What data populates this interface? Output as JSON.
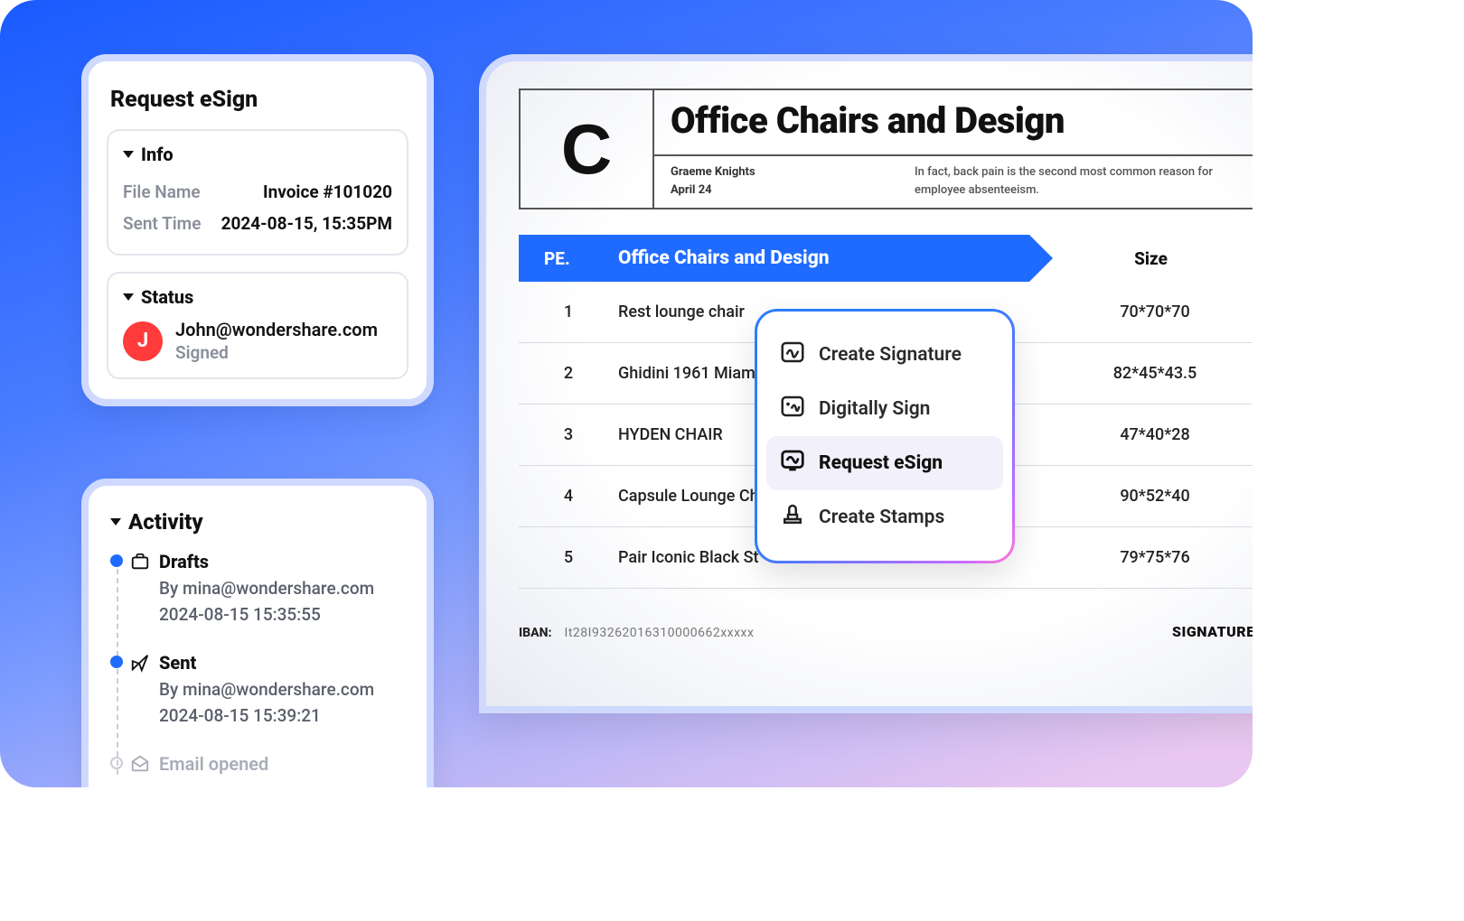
{
  "request_panel": {
    "title": "Request eSign",
    "info_section": "Info",
    "file_label": "File Name",
    "file_value": "Invoice #101020",
    "sent_label": "Sent Time",
    "sent_value": "2024-08-15, 15:35PM",
    "status_section": "Status",
    "avatar_letter": "J",
    "email": "John@wondershare.com",
    "signed": "Signed"
  },
  "activity_panel": {
    "title": "Activity",
    "items": [
      {
        "title": "Drafts",
        "by": "By mina@wondershare.com",
        "time": "2024-08-15 15:35:55"
      },
      {
        "title": "Sent",
        "by": "By mina@wondershare.com",
        "time": "2024-08-15 15:39:21"
      },
      {
        "title": "Email opened"
      }
    ]
  },
  "document": {
    "logo_letter": "C",
    "title": "Office Chairs and Design",
    "author": "Graeme Knights",
    "date": "April 24",
    "blurb": "In fact, back pain is the second most common reason for employee absenteeism.",
    "banner_pe": "PE.",
    "banner_main": "Office Chairs and Design",
    "banner_size": "Size",
    "rows": [
      {
        "n": "1",
        "name": "Rest lounge chair",
        "size": "70*70*70"
      },
      {
        "n": "2",
        "name": "Ghidini 1961 Miami",
        "size": "82*45*43.5"
      },
      {
        "n": "3",
        "name": "HYDEN CHAIR",
        "size": "47*40*28"
      },
      {
        "n": "4",
        "name": "Capsule Lounge Ch",
        "size": "90*52*40"
      },
      {
        "n": "5",
        "name": "Pair Iconic Black St",
        "size": "79*75*76"
      }
    ],
    "iban_label": "IBAN:",
    "iban_value": "It28I93262016310000662xxxxx",
    "signature_label": "SIGNATURE:"
  },
  "context_menu": {
    "items": [
      "Create Signature",
      "Digitally Sign",
      "Request eSign",
      "Create Stamps"
    ],
    "selected_index": 2
  }
}
